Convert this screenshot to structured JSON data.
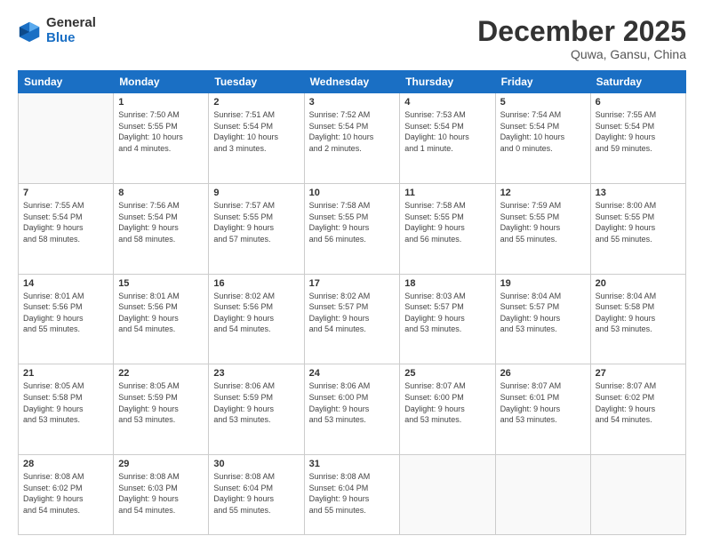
{
  "logo": {
    "general": "General",
    "blue": "Blue"
  },
  "header": {
    "month": "December 2025",
    "location": "Quwa, Gansu, China"
  },
  "weekdays": [
    "Sunday",
    "Monday",
    "Tuesday",
    "Wednesday",
    "Thursday",
    "Friday",
    "Saturday"
  ],
  "weeks": [
    [
      {
        "day": "",
        "info": ""
      },
      {
        "day": "1",
        "info": "Sunrise: 7:50 AM\nSunset: 5:55 PM\nDaylight: 10 hours\nand 4 minutes."
      },
      {
        "day": "2",
        "info": "Sunrise: 7:51 AM\nSunset: 5:54 PM\nDaylight: 10 hours\nand 3 minutes."
      },
      {
        "day": "3",
        "info": "Sunrise: 7:52 AM\nSunset: 5:54 PM\nDaylight: 10 hours\nand 2 minutes."
      },
      {
        "day": "4",
        "info": "Sunrise: 7:53 AM\nSunset: 5:54 PM\nDaylight: 10 hours\nand 1 minute."
      },
      {
        "day": "5",
        "info": "Sunrise: 7:54 AM\nSunset: 5:54 PM\nDaylight: 10 hours\nand 0 minutes."
      },
      {
        "day": "6",
        "info": "Sunrise: 7:55 AM\nSunset: 5:54 PM\nDaylight: 9 hours\nand 59 minutes."
      }
    ],
    [
      {
        "day": "7",
        "info": "Sunrise: 7:55 AM\nSunset: 5:54 PM\nDaylight: 9 hours\nand 58 minutes."
      },
      {
        "day": "8",
        "info": "Sunrise: 7:56 AM\nSunset: 5:54 PM\nDaylight: 9 hours\nand 58 minutes."
      },
      {
        "day": "9",
        "info": "Sunrise: 7:57 AM\nSunset: 5:55 PM\nDaylight: 9 hours\nand 57 minutes."
      },
      {
        "day": "10",
        "info": "Sunrise: 7:58 AM\nSunset: 5:55 PM\nDaylight: 9 hours\nand 56 minutes."
      },
      {
        "day": "11",
        "info": "Sunrise: 7:58 AM\nSunset: 5:55 PM\nDaylight: 9 hours\nand 56 minutes."
      },
      {
        "day": "12",
        "info": "Sunrise: 7:59 AM\nSunset: 5:55 PM\nDaylight: 9 hours\nand 55 minutes."
      },
      {
        "day": "13",
        "info": "Sunrise: 8:00 AM\nSunset: 5:55 PM\nDaylight: 9 hours\nand 55 minutes."
      }
    ],
    [
      {
        "day": "14",
        "info": "Sunrise: 8:01 AM\nSunset: 5:56 PM\nDaylight: 9 hours\nand 55 minutes."
      },
      {
        "day": "15",
        "info": "Sunrise: 8:01 AM\nSunset: 5:56 PM\nDaylight: 9 hours\nand 54 minutes."
      },
      {
        "day": "16",
        "info": "Sunrise: 8:02 AM\nSunset: 5:56 PM\nDaylight: 9 hours\nand 54 minutes."
      },
      {
        "day": "17",
        "info": "Sunrise: 8:02 AM\nSunset: 5:57 PM\nDaylight: 9 hours\nand 54 minutes."
      },
      {
        "day": "18",
        "info": "Sunrise: 8:03 AM\nSunset: 5:57 PM\nDaylight: 9 hours\nand 53 minutes."
      },
      {
        "day": "19",
        "info": "Sunrise: 8:04 AM\nSunset: 5:57 PM\nDaylight: 9 hours\nand 53 minutes."
      },
      {
        "day": "20",
        "info": "Sunrise: 8:04 AM\nSunset: 5:58 PM\nDaylight: 9 hours\nand 53 minutes."
      }
    ],
    [
      {
        "day": "21",
        "info": "Sunrise: 8:05 AM\nSunset: 5:58 PM\nDaylight: 9 hours\nand 53 minutes."
      },
      {
        "day": "22",
        "info": "Sunrise: 8:05 AM\nSunset: 5:59 PM\nDaylight: 9 hours\nand 53 minutes."
      },
      {
        "day": "23",
        "info": "Sunrise: 8:06 AM\nSunset: 5:59 PM\nDaylight: 9 hours\nand 53 minutes."
      },
      {
        "day": "24",
        "info": "Sunrise: 8:06 AM\nSunset: 6:00 PM\nDaylight: 9 hours\nand 53 minutes."
      },
      {
        "day": "25",
        "info": "Sunrise: 8:07 AM\nSunset: 6:00 PM\nDaylight: 9 hours\nand 53 minutes."
      },
      {
        "day": "26",
        "info": "Sunrise: 8:07 AM\nSunset: 6:01 PM\nDaylight: 9 hours\nand 53 minutes."
      },
      {
        "day": "27",
        "info": "Sunrise: 8:07 AM\nSunset: 6:02 PM\nDaylight: 9 hours\nand 54 minutes."
      }
    ],
    [
      {
        "day": "28",
        "info": "Sunrise: 8:08 AM\nSunset: 6:02 PM\nDaylight: 9 hours\nand 54 minutes."
      },
      {
        "day": "29",
        "info": "Sunrise: 8:08 AM\nSunset: 6:03 PM\nDaylight: 9 hours\nand 54 minutes."
      },
      {
        "day": "30",
        "info": "Sunrise: 8:08 AM\nSunset: 6:04 PM\nDaylight: 9 hours\nand 55 minutes."
      },
      {
        "day": "31",
        "info": "Sunrise: 8:08 AM\nSunset: 6:04 PM\nDaylight: 9 hours\nand 55 minutes."
      },
      {
        "day": "",
        "info": ""
      },
      {
        "day": "",
        "info": ""
      },
      {
        "day": "",
        "info": ""
      }
    ]
  ]
}
